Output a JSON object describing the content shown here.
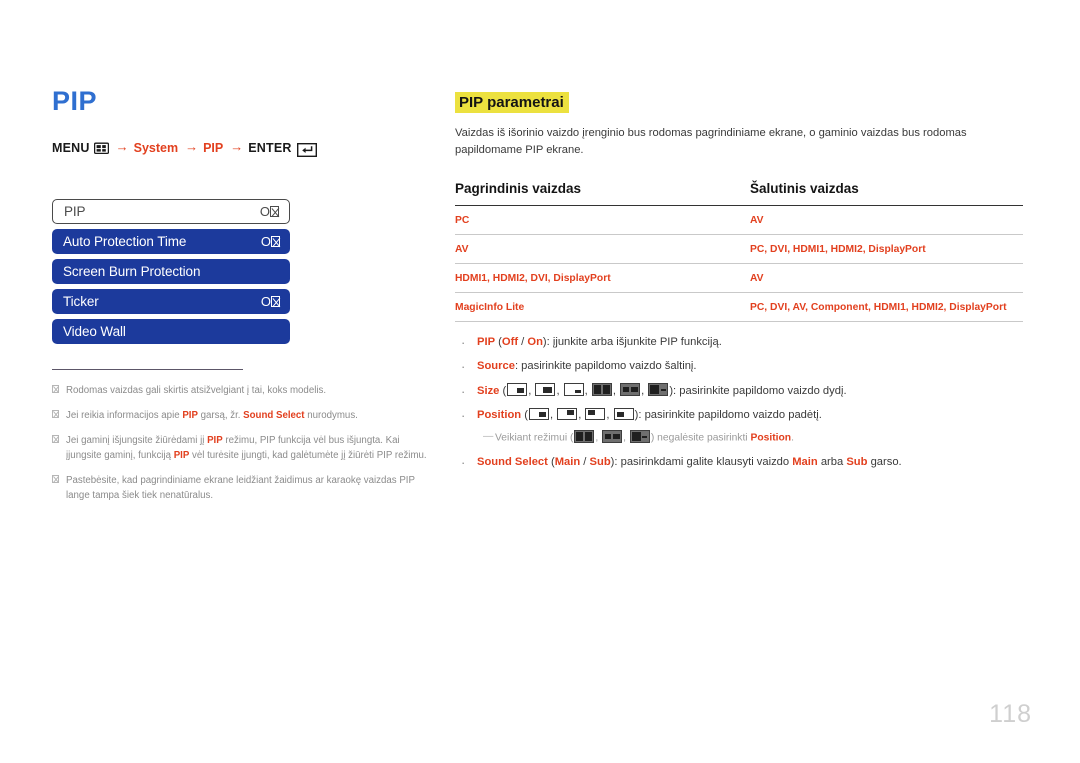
{
  "page": {
    "number": "118",
    "title": "PIP",
    "accent_blue": "#2f6fd0",
    "accent_red": "#e2401f",
    "highlight_yellow": "#ece13f",
    "osd_blue": "#1c3a9c"
  },
  "menu_path": {
    "menu_label": "MENU",
    "menu_icon": "menu-icon",
    "arrow": "→",
    "step1": "System",
    "step2": "PIP",
    "enter_label": "ENTER",
    "enter_icon": "enter-key-icon"
  },
  "osd": {
    "rows": [
      {
        "label": "PIP",
        "value": "O",
        "value_missing_glyph": true,
        "selected": true
      },
      {
        "label": "Auto Protection Time",
        "value": "O",
        "value_missing_glyph": true,
        "selected": false
      },
      {
        "label": "Screen Burn Protection",
        "value": "",
        "value_missing_glyph": false,
        "selected": false
      },
      {
        "label": "Ticker",
        "value": "O",
        "value_missing_glyph": true,
        "selected": false
      },
      {
        "label": "Video Wall",
        "value": "",
        "value_missing_glyph": false,
        "selected": false
      }
    ]
  },
  "left_notes": [
    {
      "html": "Rodomas vaizdas gali skirtis atsižvelgiant į tai, koks modelis."
    },
    {
      "html": "Jei reikia informacijos apie <b>PIP</b> garsą, žr. <b>Sound Select</b> nurodymus."
    },
    {
      "html": "Jei gaminį išjungsite žiūrėdami jį <b>PIP</b> režimu, PIP funkcija vėl bus išjungta. Kai įjungsite gaminį, funkciją <b>PIP</b> vėl turėsite įjungti, kad galėtumėte jį žiūrėti PIP režimu."
    },
    {
      "html": "Pastebėsite, kad pagrindiniame ekrane leidžiant žaidimus ar karaokę vaizdas PIP lange tampa šiek tiek nenatūralus."
    }
  ],
  "section": {
    "title": "PIP parametrai",
    "description": "Vaizdas iš išorinio vaizdo įrenginio bus rodomas pagrindiniame ekrane, o gaminio vaizdas bus rodomas papildomame PIP ekrane."
  },
  "table": {
    "headers": [
      "Pagrindinis vaizdas",
      "Šalutinis vaizdas"
    ],
    "rows": [
      [
        "PC",
        "AV"
      ],
      [
        "AV",
        "PC, DVI, HDMI1, HDMI2, DisplayPort"
      ],
      [
        "HDMI1, HDMI2, DVI, DisplayPort",
        "AV"
      ],
      [
        "MagicInfo Lite",
        "PC, DVI, AV, Component, HDMI1, HDMI2, DisplayPort"
      ]
    ]
  },
  "bullets": {
    "pip": {
      "prefix_bold": "PIP",
      "paren": " (",
      "opt1": "Off",
      "slash": " / ",
      "opt2": "On",
      "rest": "): įjunkite arba išjunkite PIP funkciją."
    },
    "source": {
      "label": "Source",
      "rest": ": pasirinkite papildomo vaizdo šaltinį."
    },
    "size": {
      "label": "Size",
      "open": " (",
      "close": "): pasirinkite papildomo vaizdo dydį.",
      "icons": [
        "pip-size-small-br",
        "pip-size-medium-br",
        "pip-size-large-br",
        "pip-size-split-half",
        "pip-size-split-wide",
        "pip-size-split-thin"
      ]
    },
    "position": {
      "label": "Position",
      "open": " (",
      "close": "): pasirinkite papildomo vaizdo padėtį.",
      "icons": [
        "pip-pos-bottom-right",
        "pip-pos-top-right",
        "pip-pos-top-left",
        "pip-pos-bottom-left"
      ]
    },
    "position_note": {
      "pre": "Veikiant režimui (",
      "mid": ") negalėsite pasirinkti ",
      "bold": "Position",
      "post": ".",
      "icons": [
        "pip-size-split-half",
        "pip-size-split-wide",
        "pip-size-split-thin"
      ]
    },
    "sound": {
      "label": "Sound Select",
      "paren": " (",
      "opt1": "Main",
      "slash": " / ",
      "opt2": "Sub",
      "mid": "): pasirinkdami galite klausyti vaizdo ",
      "b1": "Main",
      "mid2": " arba ",
      "b2": "Sub",
      "post": " garso."
    }
  }
}
